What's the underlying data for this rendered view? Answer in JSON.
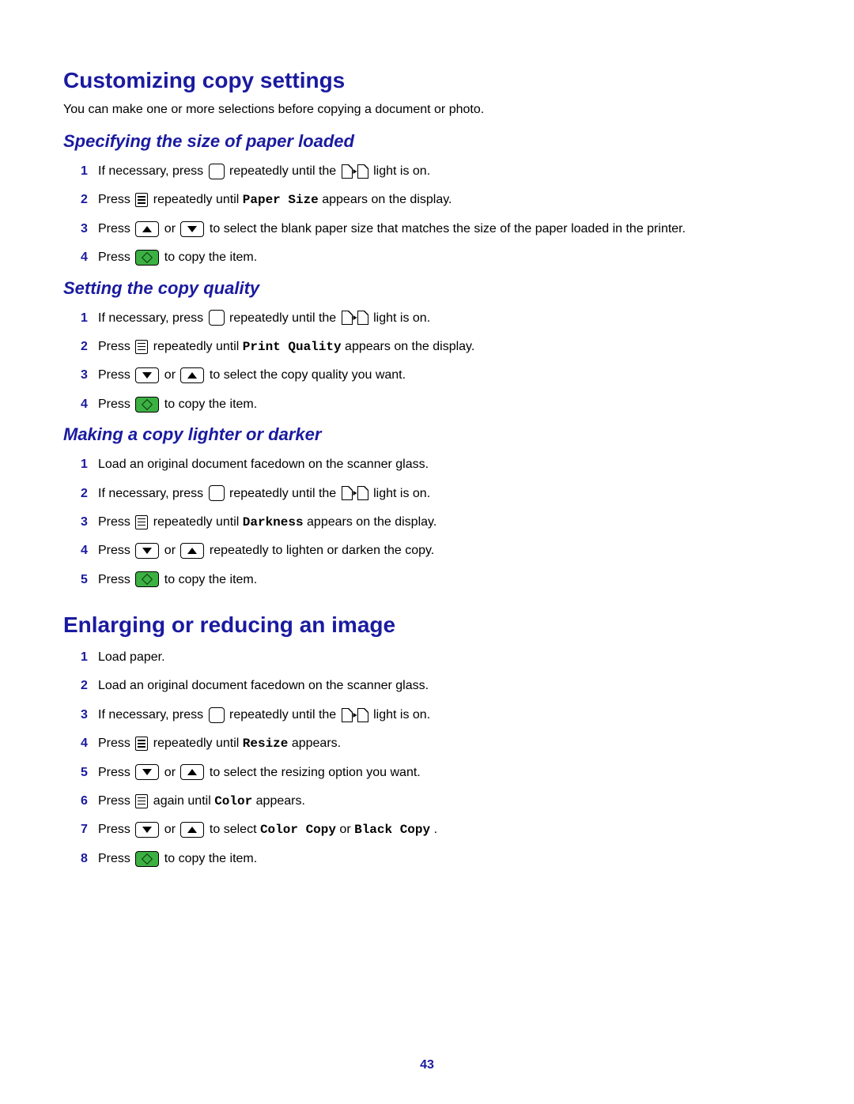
{
  "page_number": "43",
  "heading1": "Customizing copy settings",
  "intro": "You can make one or more selections before copying a document or photo.",
  "section1": {
    "title": "Specifying the size of paper loaded",
    "steps": {
      "1a": "If necessary, press ",
      "1b": " repeatedly until the ",
      "1c": " light is on.",
      "2a": "Press ",
      "2b": " repeatedly until ",
      "2c": "Paper Size",
      "2d": " appears on the display.",
      "3a": "Press ",
      "3b": " or ",
      "3c": " to select the blank paper size that matches the size of the paper loaded in the printer.",
      "4a": "Press ",
      "4b": " to copy the item."
    }
  },
  "section2": {
    "title": "Setting the copy quality",
    "steps": {
      "1a": "If necessary, press ",
      "1b": " repeatedly until the ",
      "1c": " light is on.",
      "2a": "Press ",
      "2b": " repeatedly until ",
      "2c": "Print Quality",
      "2d": " appears on the display.",
      "3a": "Press ",
      "3b": " or ",
      "3c": " to select the copy quality you want.",
      "4a": "Press ",
      "4b": " to copy the item."
    }
  },
  "section3": {
    "title": "Making a copy lighter or darker",
    "steps": {
      "1": "Load an original document facedown on the scanner glass.",
      "2a": "If necessary, press ",
      "2b": " repeatedly until the ",
      "2c": " light is on.",
      "3a": "Press ",
      "3b": " repeatedly until ",
      "3c": "Darkness",
      "3d": " appears on the display.",
      "4a": "Press ",
      "4b": " or ",
      "4c": " repeatedly to lighten or darken the copy.",
      "5a": "Press ",
      "5b": " to copy the item."
    }
  },
  "heading2": "Enlarging or reducing an image",
  "section4": {
    "steps": {
      "1": "Load paper.",
      "2": "Load an original document facedown on the scanner glass.",
      "3a": "If necessary, press ",
      "3b": " repeatedly until the ",
      "3c": " light is on.",
      "4a": "Press ",
      "4b": " repeatedly until ",
      "4c": "Resize",
      "4d": " appears.",
      "5a": "Press ",
      "5b": " or ",
      "5c": " to select the resizing option you want.",
      "6a": "Press ",
      "6b": " again until ",
      "6c": "Color",
      "6d": " appears.",
      "7a": "Press ",
      "7b": " or ",
      "7c": " to select ",
      "7d": "Color Copy",
      "7e": " or ",
      "7f": "Black Copy",
      "7g": ".",
      "8a": "Press ",
      "8b": " to copy the item."
    }
  }
}
